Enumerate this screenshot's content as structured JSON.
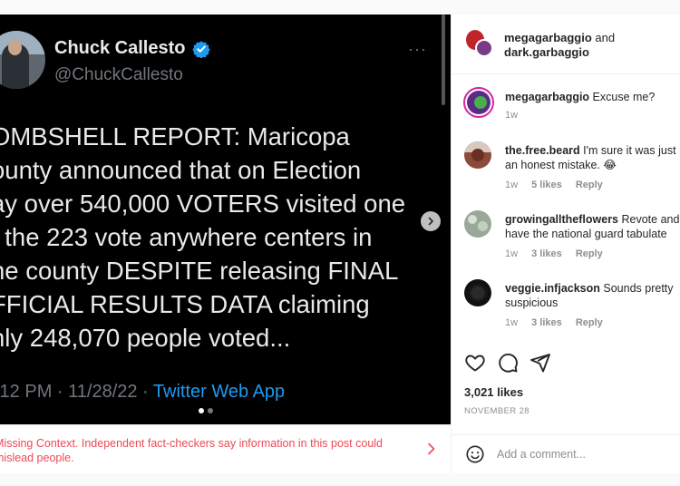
{
  "tweet": {
    "author_name": "Chuck Callesto",
    "author_handle": "@ChuckCallesto",
    "text_lines": [
      "OMBSHELL REPORT: Maricopa",
      "ounty announced that on Election",
      "ay over 540,000 VOTERS visited one",
      "f the 223 vote anywhere centers in",
      "he county DESPITE releasing FINAL",
      "FFICIAL RESULTS DATA claiming",
      "nly 248,070 people voted..."
    ],
    "timestamp": ":12 PM · 11/28/22 · ",
    "app": "Twitter Web App",
    "more_icon": "···"
  },
  "carousel": {
    "total": 2,
    "current": 1
  },
  "warning": {
    "text": "Missing Context. Independent fact-checkers say information in this post could mislead people.",
    "color": "#ed4956"
  },
  "header": {
    "user1": "megagarbaggio",
    "connector": " and",
    "user2": "dark.garbaggio"
  },
  "comments": [
    {
      "user": "megagarbaggio",
      "text": " Excuse me?",
      "time": "1w",
      "likes": "",
      "reply": ""
    },
    {
      "user": "the.free.beard",
      "text": " I'm sure it was just an honest mistake. 😂",
      "time": "1w",
      "likes": "5 likes",
      "reply": "Reply"
    },
    {
      "user": "growingalltheflowers",
      "text": " Revote and have the national guard tabulate",
      "time": "1w",
      "likes": "3 likes",
      "reply": "Reply"
    },
    {
      "user": "veggie.infjackson",
      "text": " Sounds pretty suspicious",
      "time": "1w",
      "likes": "3 likes",
      "reply": "Reply"
    }
  ],
  "stats": {
    "likes": "3,021 likes",
    "date": "NOVEMBER 28"
  },
  "add_comment": {
    "placeholder": "Add a comment..."
  },
  "colors": {
    "verified": "#1d9bf0",
    "link": "#1d9bf0"
  }
}
